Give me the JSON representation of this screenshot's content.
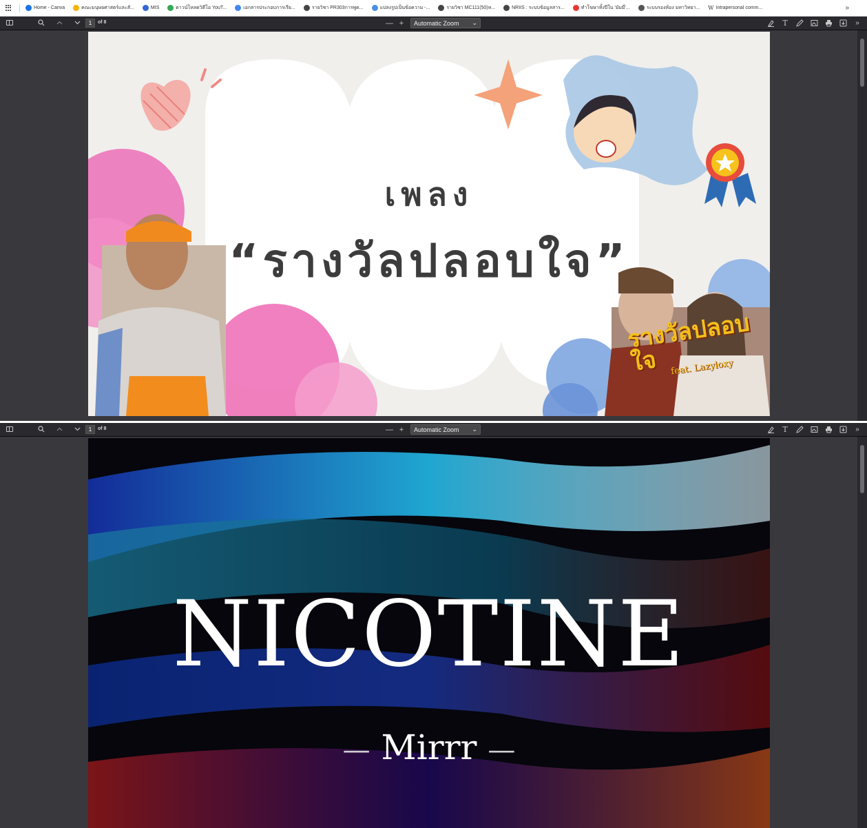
{
  "bookmarks": [
    {
      "label": "Home - Canva",
      "color": "#1a73e8"
    },
    {
      "label": "คณะมนุษยศาสตร์และสั...",
      "color": "#f4b400"
    },
    {
      "label": "MIS",
      "color": "#3367d6"
    },
    {
      "label": "ดาวน์โหลดวิดีโอ YouT...",
      "color": "#34a853"
    },
    {
      "label": "เอกสารประกอบการเรีย...",
      "color": "#4285f4"
    },
    {
      "label": "รายวิชา PR303การพูด...",
      "color": "#444444"
    },
    {
      "label": "แปลงรูปเป็นข้อความ -...",
      "color": "#4a90e2"
    },
    {
      "label": "รายวิชา MC111(50)ห...",
      "color": "#444444"
    },
    {
      "label": "NRIIS : ระบบข้อมูลสาร...",
      "color": "#444444"
    },
    {
      "label": "ทำโฆษาทั้งปีใน 'มัมมี่'...",
      "color": "#e53935"
    },
    {
      "label": "ระบบรองห้อง มหาวิทยา...",
      "color": "#555555"
    },
    {
      "label": "Intrapersonal comm...",
      "color": "#333333",
      "glyph": "W"
    }
  ],
  "bookmarks_more": "»",
  "viewer": {
    "page_number": "1",
    "page_of": "of 8",
    "zoom_label": "Automatic Zoom",
    "zoom_out": "—",
    "zoom_in": "+",
    "chevron": "⌄",
    "more": "»"
  },
  "slide1": {
    "line1": "เพลง",
    "line2": "“รางวัลปลอบใจ”",
    "mv_title": "รางวัลปลอบใจ",
    "mv_feat": "feat. Lazyloxy"
  },
  "slide2": {
    "title": "NICOTINE",
    "artist": "Mirrr",
    "dash_left": "—",
    "dash_right": "—"
  },
  "colors": {
    "viewer_bg": "#38383d",
    "toolbar_bg": "#2a2a2e",
    "slide1_bg": "#f0efec",
    "slide2_bg": "#06060c"
  }
}
